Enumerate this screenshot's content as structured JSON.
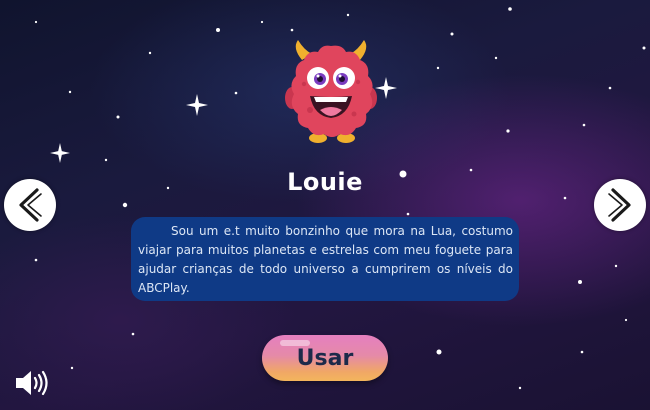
{
  "character": {
    "name": "Louie",
    "description": "Sou um e.t muito bonzinho que mora na Lua, costumo viajar para muitos  planetas e estrelas com meu foguete para ajudar crianças de todo universo a cumprirem os níveis do ABCPlay."
  },
  "actions": {
    "use_label": "Usar"
  },
  "icons": {
    "prev": "chevron-left-icon",
    "next": "chevron-right-icon",
    "sound": "speaker-icon",
    "character": "monster-icon"
  },
  "colors": {
    "description_box": "#0f3a86",
    "button_gradient_top": "#e57fc0",
    "button_gradient_bottom": "#f3b55c",
    "monster_body": "#e0455d"
  }
}
